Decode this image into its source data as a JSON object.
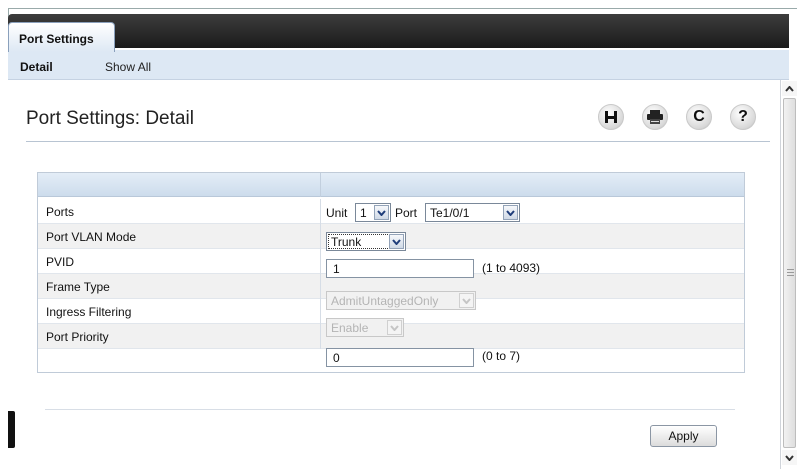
{
  "tabs": {
    "active_label": "Port Settings"
  },
  "subtabs": {
    "detail": "Detail",
    "show_all": "Show All"
  },
  "page": {
    "title": "Port Settings: Detail"
  },
  "toolbar_icons": [
    "save-icon",
    "print-icon",
    "refresh-icon",
    "help-icon"
  ],
  "toolbar_glyphs": {
    "refresh": "C",
    "help": "?"
  },
  "form": {
    "ports": {
      "label": "Ports",
      "unit_label": "Unit",
      "unit_value": "1",
      "port_label": "Port",
      "port_value": "Te1/0/1"
    },
    "vlan_mode": {
      "label": "Port VLAN Mode",
      "value": "Trunk"
    },
    "pvid": {
      "label": "PVID",
      "value": "1",
      "hint": "(1 to 4093)"
    },
    "frame_type": {
      "label": "Frame Type",
      "value": "AdmitUntaggedOnly"
    },
    "ingress": {
      "label": "Ingress Filtering",
      "value": "Enable"
    },
    "priority": {
      "label": "Port Priority",
      "value": "0",
      "hint": "(0 to 7)"
    }
  },
  "buttons": {
    "apply": "Apply"
  },
  "colors": {
    "tab_bar": "#1a1a1a",
    "subbar": "#dde8f4",
    "panel_header": "#cddcec",
    "alt_row": "#f1f1f1"
  }
}
